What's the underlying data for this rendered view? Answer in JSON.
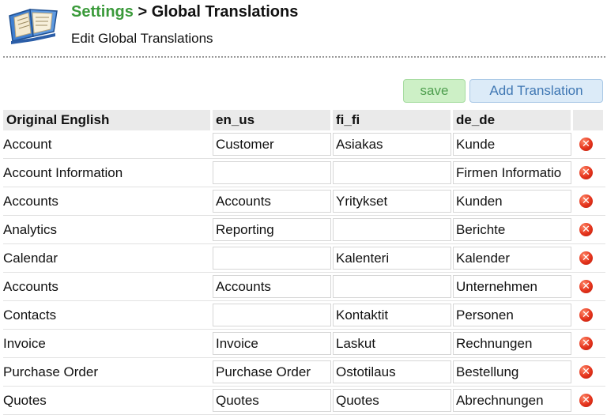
{
  "header": {
    "breadcrumb_root": "Settings",
    "breadcrumb_separator": ">",
    "page_title": "Global Translations",
    "subtitle": "Edit Global Translations",
    "logo_icon": "open-book-icon"
  },
  "toolbar": {
    "save_label": "save",
    "add_label": "Add Translation"
  },
  "table": {
    "columns": [
      "Original English",
      "en_us",
      "fi_fi",
      "de_de"
    ],
    "rows": [
      {
        "original": "Account",
        "en_us": "Customer",
        "fi_fi": "Asiakas",
        "de_de": "Kunde"
      },
      {
        "original": "Account Information",
        "en_us": "",
        "fi_fi": "",
        "de_de": "Firmen Informatio"
      },
      {
        "original": "Accounts",
        "en_us": "Accounts",
        "fi_fi": "Yritykset",
        "de_de": "Kunden"
      },
      {
        "original": "Analytics",
        "en_us": "Reporting",
        "fi_fi": "",
        "de_de": "Berichte"
      },
      {
        "original": "Calendar",
        "en_us": "",
        "fi_fi": "Kalenteri",
        "de_de": "Kalender"
      },
      {
        "original": "Accounts",
        "en_us": "Accounts",
        "fi_fi": "",
        "de_de": "Unternehmen"
      },
      {
        "original": "Contacts",
        "en_us": "",
        "fi_fi": "Kontaktit",
        "de_de": "Personen"
      },
      {
        "original": "Invoice",
        "en_us": "Invoice",
        "fi_fi": "Laskut",
        "de_de": "Rechnungen"
      },
      {
        "original": "Purchase Order",
        "en_us": "Purchase Order",
        "fi_fi": "Ostotilaus",
        "de_de": "Bestellung"
      },
      {
        "original": "Quotes",
        "en_us": "Quotes",
        "fi_fi": "Quotes",
        "de_de": "Abrechnungen"
      }
    ],
    "delete_icon": "delete-x-icon"
  },
  "colors": {
    "breadcrumb_green": "#3a9a3a",
    "save_bg": "#cdf0c6",
    "add_bg": "#dcebf8",
    "header_row_bg": "#eaeaea",
    "delete_red": "#e4321b"
  }
}
